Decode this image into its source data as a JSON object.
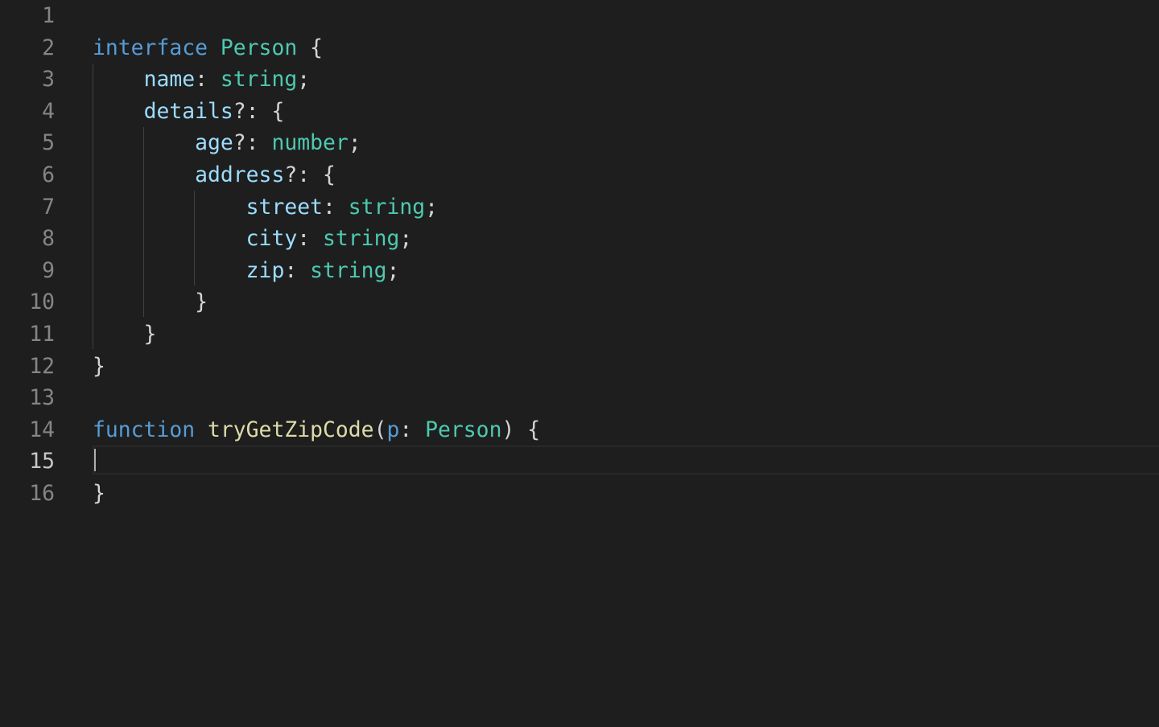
{
  "colors": {
    "background": "#1e1e1e",
    "keyword": "#569cd6",
    "type": "#4ec9b0",
    "property": "#9cdcfe",
    "function": "#dcdcaa",
    "punctuation": "#d4d4d4",
    "line_number": "#858585",
    "line_number_active": "#c6c6c6"
  },
  "editor": {
    "active_line": 15,
    "line_numbers": [
      "1",
      "2",
      "3",
      "4",
      "5",
      "6",
      "7",
      "8",
      "9",
      "10",
      "11",
      "12",
      "13",
      "14",
      "15",
      "16"
    ],
    "lines": [
      [],
      [
        {
          "t": "interface",
          "c": "keyword"
        },
        {
          "t": " ",
          "c": "punctuation"
        },
        {
          "t": "Person",
          "c": "type"
        },
        {
          "t": " {",
          "c": "punctuation"
        }
      ],
      [
        {
          "t": "    ",
          "c": "punctuation"
        },
        {
          "t": "name",
          "c": "property"
        },
        {
          "t": ": ",
          "c": "punctuation"
        },
        {
          "t": "string",
          "c": "type"
        },
        {
          "t": ";",
          "c": "punctuation"
        }
      ],
      [
        {
          "t": "    ",
          "c": "punctuation"
        },
        {
          "t": "details",
          "c": "property"
        },
        {
          "t": "?: {",
          "c": "punctuation"
        }
      ],
      [
        {
          "t": "        ",
          "c": "punctuation"
        },
        {
          "t": "age",
          "c": "property"
        },
        {
          "t": "?: ",
          "c": "punctuation"
        },
        {
          "t": "number",
          "c": "type"
        },
        {
          "t": ";",
          "c": "punctuation"
        }
      ],
      [
        {
          "t": "        ",
          "c": "punctuation"
        },
        {
          "t": "address",
          "c": "property"
        },
        {
          "t": "?: {",
          "c": "punctuation"
        }
      ],
      [
        {
          "t": "            ",
          "c": "punctuation"
        },
        {
          "t": "street",
          "c": "property"
        },
        {
          "t": ": ",
          "c": "punctuation"
        },
        {
          "t": "string",
          "c": "type"
        },
        {
          "t": ";",
          "c": "punctuation"
        }
      ],
      [
        {
          "t": "            ",
          "c": "punctuation"
        },
        {
          "t": "city",
          "c": "property"
        },
        {
          "t": ": ",
          "c": "punctuation"
        },
        {
          "t": "string",
          "c": "type"
        },
        {
          "t": ";",
          "c": "punctuation"
        }
      ],
      [
        {
          "t": "            ",
          "c": "punctuation"
        },
        {
          "t": "zip",
          "c": "property"
        },
        {
          "t": ": ",
          "c": "punctuation"
        },
        {
          "t": "string",
          "c": "type"
        },
        {
          "t": ";",
          "c": "punctuation"
        }
      ],
      [
        {
          "t": "        }",
          "c": "punctuation"
        }
      ],
      [
        {
          "t": "    }",
          "c": "punctuation"
        }
      ],
      [
        {
          "t": "}",
          "c": "punctuation"
        }
      ],
      [],
      [
        {
          "t": "function",
          "c": "keyword"
        },
        {
          "t": " ",
          "c": "punctuation"
        },
        {
          "t": "tryGetZipCode",
          "c": "function"
        },
        {
          "t": "(",
          "c": "punctuation"
        },
        {
          "t": "p",
          "c": "keyword"
        },
        {
          "t": ": ",
          "c": "punctuation"
        },
        {
          "t": "Person",
          "c": "type"
        },
        {
          "t": ") {",
          "c": "punctuation"
        }
      ],
      [],
      [
        {
          "t": "}",
          "c": "punctuation"
        }
      ]
    ]
  }
}
